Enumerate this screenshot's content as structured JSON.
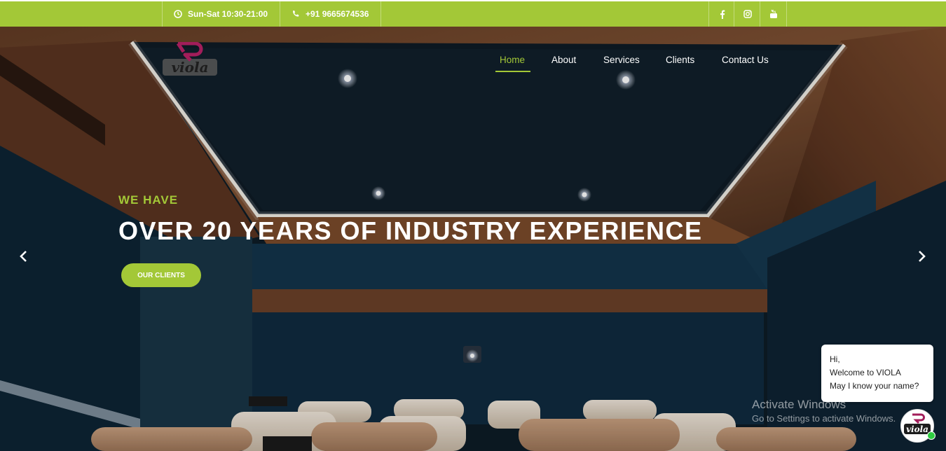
{
  "topbar": {
    "hours": "Sun-Sat 10:30-21:00",
    "phone": "+91 9665674536",
    "hours_icon": "clock-icon",
    "phone_icon": "phone-icon",
    "social": [
      "facebook-icon",
      "instagram-icon",
      "youtube-icon"
    ]
  },
  "brand": {
    "logo_text": "viola"
  },
  "nav": {
    "items": [
      "Home",
      "About",
      "Services",
      "Clients",
      "Contact Us"
    ],
    "active": "Home"
  },
  "hero": {
    "eyebrow": "WE HAVE",
    "headline": "OVER 20 YEARS OF INDUSTRY EXPERIENCE",
    "cta_label": "OUR CLIENTS"
  },
  "chat": {
    "line1": "Hi,",
    "line2": "Welcome to VIOLA",
    "line3": "May I know your name?",
    "avatar_text": "viola"
  },
  "watermark": {
    "line1": "Activate Windows",
    "line2": "Go to Settings to activate Windows."
  },
  "colors": {
    "accent": "#a3c837",
    "online": "#2ecc40"
  }
}
